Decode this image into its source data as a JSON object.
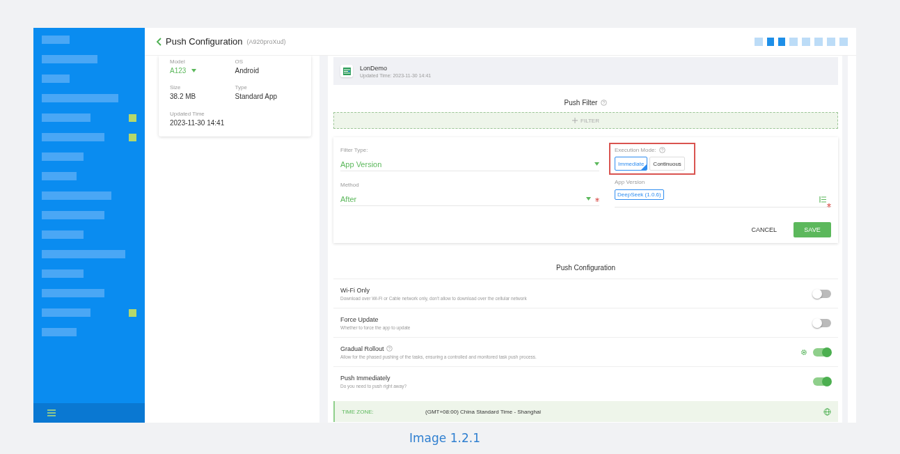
{
  "header": {
    "title": "Push Configuration",
    "subtitle": "(A920proXud)"
  },
  "app_info": {
    "fields": [
      {
        "label": "Model",
        "value": "A123",
        "kind": "dropdown"
      },
      {
        "label": "OS",
        "value": "Android",
        "kind": "text"
      },
      {
        "label": "Size",
        "value": "38.2 MB",
        "kind": "text"
      },
      {
        "label": "Type",
        "value": "Standard App",
        "kind": "text"
      },
      {
        "label": "Updated Time",
        "value": "2023-11-30 14:41",
        "kind": "text"
      }
    ]
  },
  "app": {
    "name": "LonDemo",
    "updated": "Updated Time: 2023-11-30 14:41"
  },
  "push_filter": {
    "title": "Push Filter",
    "add_label": "FILTER",
    "filter_type": {
      "label": "Filter Type:",
      "value": "App Version"
    },
    "method": {
      "label": "Method",
      "value": "After",
      "required": true
    },
    "execution_mode": {
      "label": "Execution Mode:",
      "highlighted": true,
      "options": [
        {
          "label": "Immediate",
          "selected": true
        },
        {
          "label": "Continuous",
          "selected": false
        }
      ]
    },
    "app_version": {
      "label": "App Version",
      "required": true,
      "tags": [
        "DeepSeek (1.0.6)"
      ]
    },
    "cancel": "CANCEL",
    "save": "SAVE"
  },
  "push_configuration": {
    "title": "Push Configuration",
    "settings": [
      {
        "title": "Wi-Fi Only",
        "description": "Download over Wi-Fi or Cable network only, don't allow to download over the cellular network",
        "on": false,
        "help": false,
        "configurable": false
      },
      {
        "title": "Force Update",
        "description": "Whether to force the app to update",
        "on": false,
        "help": false,
        "configurable": false
      },
      {
        "title": "Gradual Rollout",
        "description": "Allow for the phased pushing of the tasks, ensuring a controlled and monitored task push process.",
        "on": true,
        "help": true,
        "configurable": true
      },
      {
        "title": "Push Immediately",
        "description": "Do you need to push right away?",
        "on": true,
        "help": false,
        "configurable": false
      }
    ]
  },
  "time_zone": {
    "label": "TIME ZONE:",
    "value": "(GMT+08:00) China Standard Time - Shanghai"
  },
  "caption": "Image 1.2.1"
}
